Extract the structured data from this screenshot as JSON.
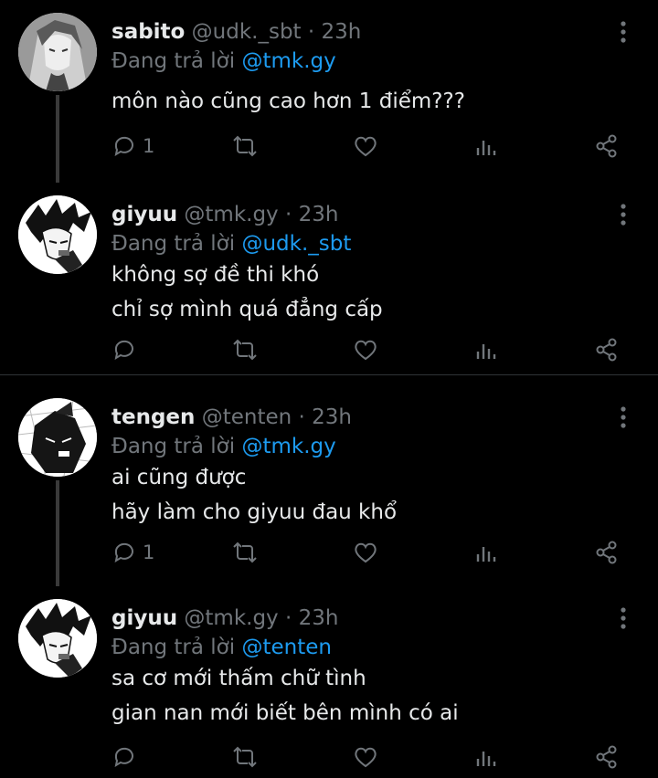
{
  "tweets": [
    {
      "name": "sabito",
      "handle": "@udk._sbt",
      "sep": "·",
      "time": "23h",
      "reply_prefix": "Đang trả lời",
      "reply_to": "@tmk.gy",
      "lines": [
        "môn nào cũng cao hơn 1 điểm???"
      ],
      "reply_count": "1",
      "avatar_icon": "avatar-sabito"
    },
    {
      "name": "giyuu",
      "handle": "@tmk.gy",
      "sep": "·",
      "time": "23h",
      "reply_prefix": "Đang trả lời",
      "reply_to": "@udk._sbt",
      "lines": [
        "không sợ đề thi khó",
        "chỉ sợ mình quá đẳng cấp"
      ],
      "reply_count": "",
      "avatar_icon": "avatar-giyuu"
    },
    {
      "name": "tengen",
      "handle": "@tenten",
      "sep": "·",
      "time": "23h",
      "reply_prefix": "Đang trả lời",
      "reply_to": "@tmk.gy",
      "lines": [
        "ai cũng được",
        "hãy làm cho giyuu đau khổ"
      ],
      "reply_count": "1",
      "avatar_icon": "avatar-tengen"
    },
    {
      "name": "giyuu",
      "handle": "@tmk.gy",
      "sep": "·",
      "time": "23h",
      "reply_prefix": "Đang trả lời",
      "reply_to": "@tenten",
      "lines": [
        "sa cơ mới thấm chữ tình",
        "gian nan mới biết bên mình có ai"
      ],
      "reply_count": "",
      "avatar_icon": "avatar-giyuu"
    }
  ],
  "icons": [
    "reply-icon",
    "retweet-icon",
    "like-icon",
    "stats-icon",
    "share-icon",
    "more-icon"
  ],
  "colors": {
    "background": "#000000",
    "text": "#e7e9ea",
    "muted": "#71767b",
    "mention": "#1d9bf0",
    "divider": "#2f3336"
  }
}
